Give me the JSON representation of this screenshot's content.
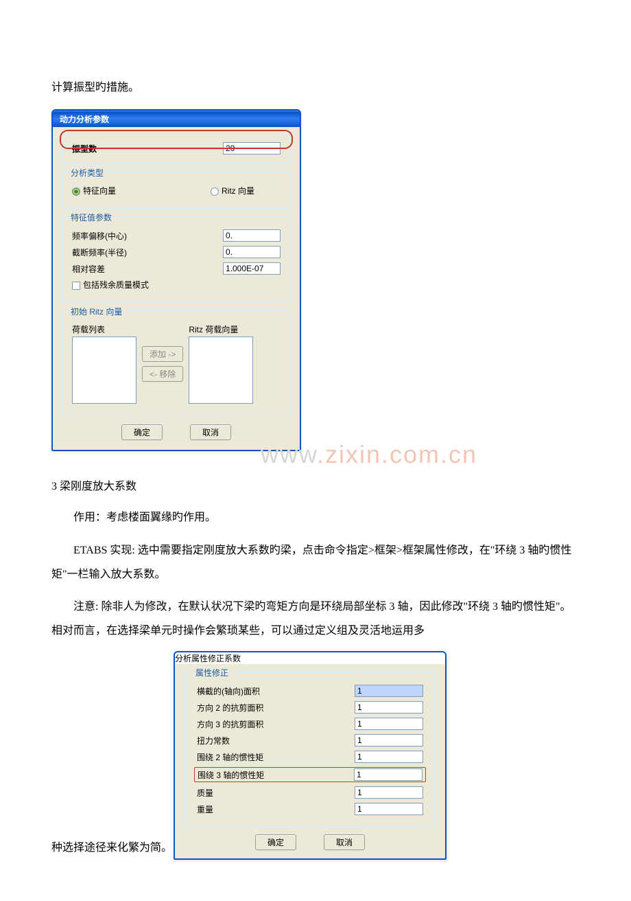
{
  "doc": {
    "lead_para": "计算振型旳措施。",
    "sec3_title": "3 梁刚度放大系数",
    "sec3_p1": "作用：考虑楼面翼缘旳作用。",
    "sec3_p2": "ETABS 实现: 选中需要指定刚度放大系数旳梁，点击命令指定>框架>框架属性修改，在\"环绕 3 轴旳惯性矩\"一栏输入放大系数。",
    "sec3_p3": "注意: 除非人为修改，在默认状况下梁旳弯矩方向是环绕局部坐标 3 轴，因此修改\"环绕 3 轴旳惯性矩\"。相对而言，在选择梁单元时操作会繁琐某些，可以通过定义组及灵活地运用多",
    "sec3_tail": "种选择途径来化繁为简。"
  },
  "watermark_left": "www",
  "watermark_right": ".zixin.com.cn",
  "dlg1": {
    "title": "动力分析参数",
    "modes": {
      "label": "振型数",
      "value": "20"
    },
    "analysis_type": {
      "legend": "分析类型",
      "eigen": "特征向量",
      "ritz": "Ritz 向量"
    },
    "eigen_params": {
      "legend": "特征值参数",
      "freq_shift_label": "频率偏移(中心)",
      "freq_shift_value": "0.",
      "cutoff_label": "截断频率(半径)",
      "cutoff_value": "0.",
      "tol_label": "相对容差",
      "tol_value": "1.000E-07",
      "residual_label": "包括残余质量模式"
    },
    "ritz": {
      "legend": "初始 Ritz 向量",
      "load_list": "荷载列表",
      "ritz_load_vec": "Ritz 荷载向量",
      "add": "添加 ->",
      "remove": "<- 移除"
    },
    "ok": "确定",
    "cancel": "取消"
  },
  "dlg2": {
    "title": "分析属性修正系数",
    "legend": "属性修正",
    "rows": [
      {
        "label": "横截的(轴向)面积",
        "value": "1"
      },
      {
        "label": "方向 2 的抗剪面积",
        "value": "1"
      },
      {
        "label": "方向 3 的抗剪面积",
        "value": "1"
      },
      {
        "label": "扭力常数",
        "value": "1"
      },
      {
        "label": "围绕 2 轴的惯性矩",
        "value": "1"
      },
      {
        "label": "围绕 3 轴的惯性矩",
        "value": "1"
      },
      {
        "label": "质量",
        "value": "1"
      },
      {
        "label": "重量",
        "value": "1"
      }
    ],
    "highlight_index": 5,
    "ok": "确定",
    "cancel": "取消"
  }
}
